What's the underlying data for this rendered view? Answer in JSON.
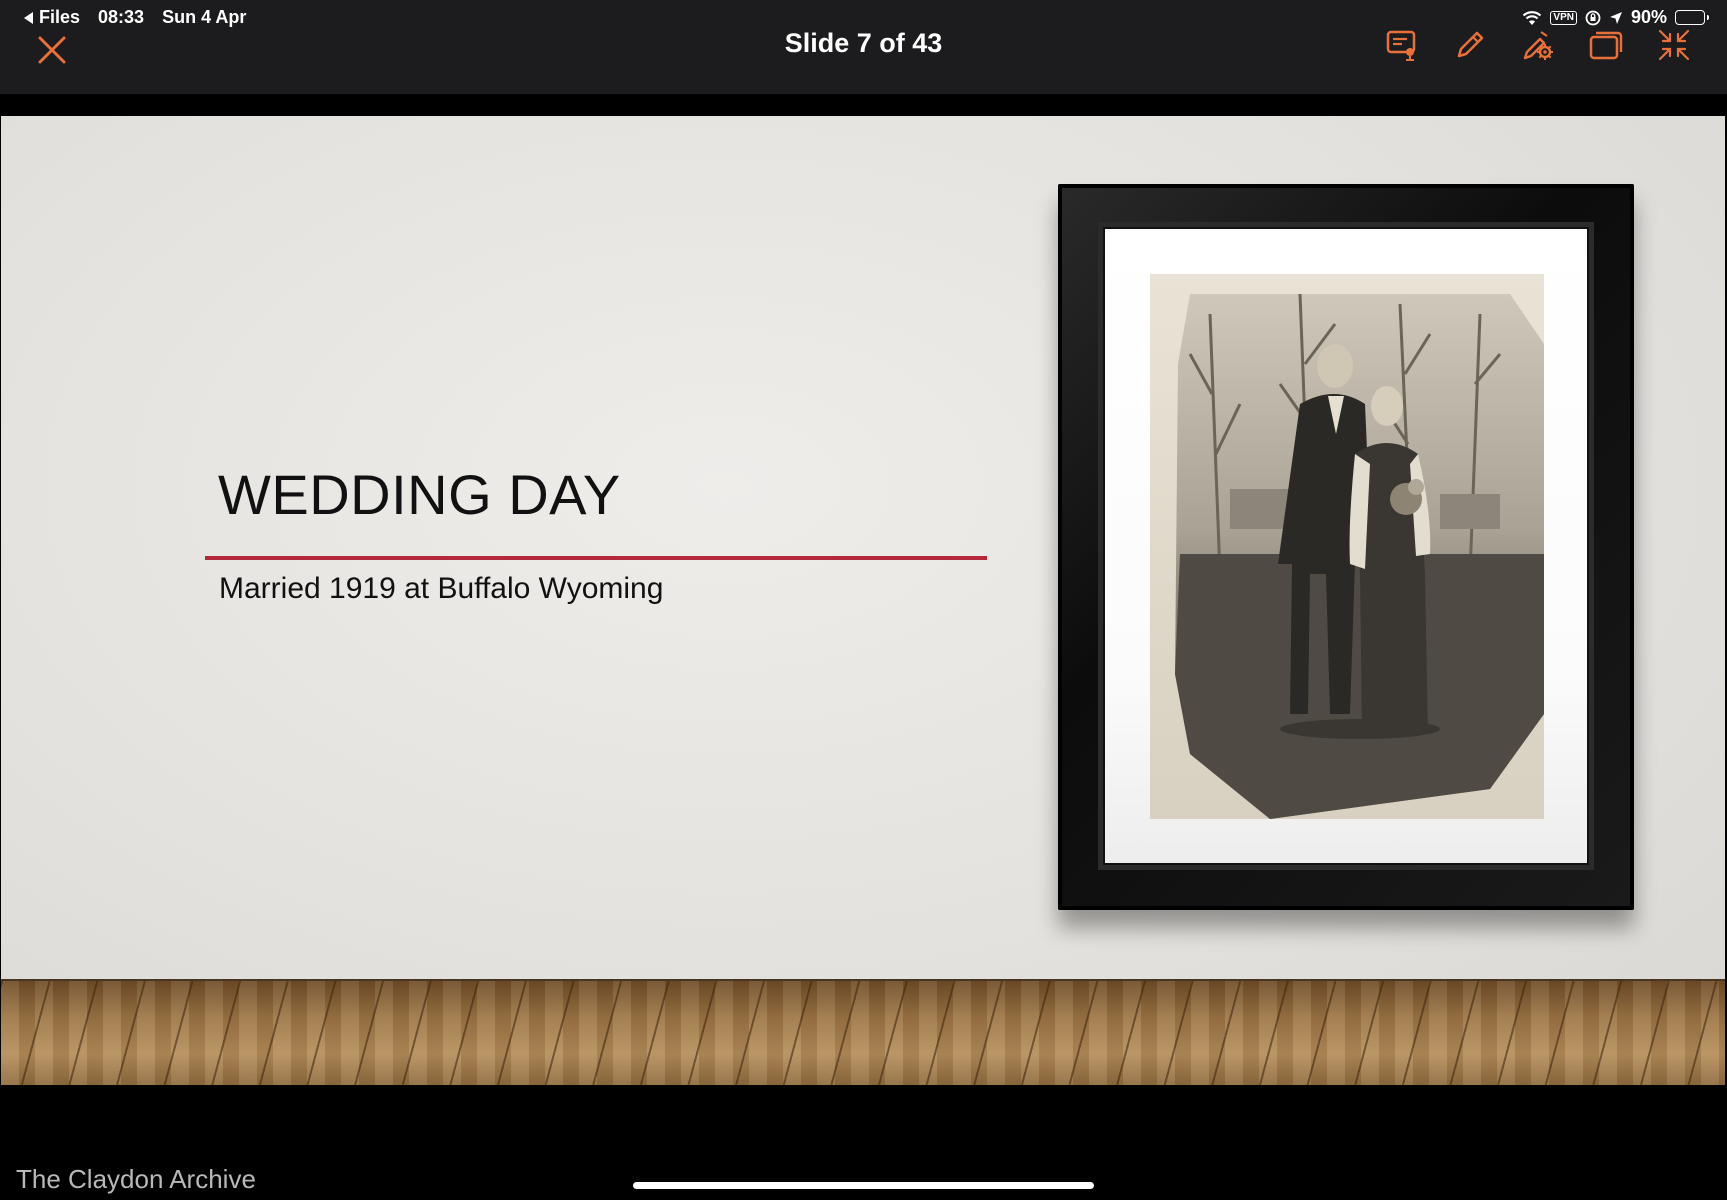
{
  "status_bar": {
    "back_app": "Files",
    "time": "08:33",
    "date": "Sun 4 Apr",
    "vpn": "VPN",
    "battery": "90%",
    "battery_level": 0.9
  },
  "header": {
    "slide_counter": "Slide 7 of 43"
  },
  "toolbar": {
    "icons": [
      "presenter-notes-icon",
      "pencil-icon",
      "laser-settings-icon",
      "window-icon",
      "minimize-icon"
    ],
    "accent": "#e8703a"
  },
  "slide": {
    "title": "WEDDING DAY",
    "subtitle": "Married 1919 at Buffalo Wyoming",
    "rule_color": "#b5283a"
  },
  "footer": {
    "watermark": "The Claydon Archive"
  }
}
